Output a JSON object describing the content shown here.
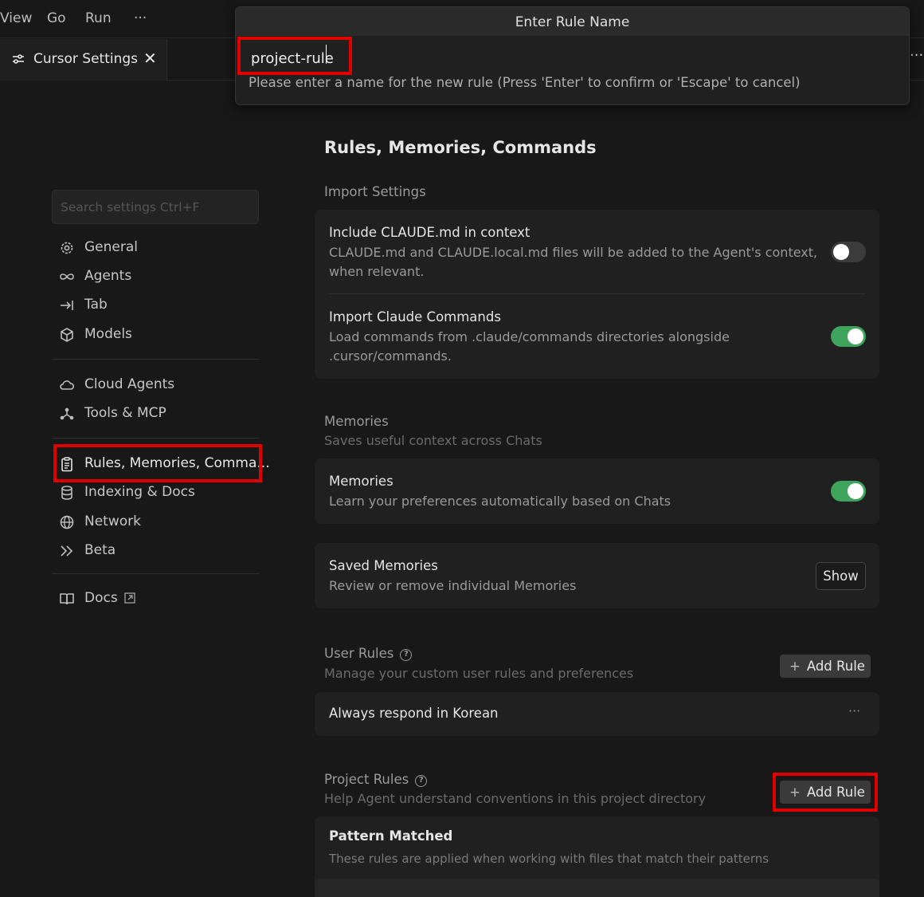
{
  "menubar": {
    "items": [
      "View",
      "Go",
      "Run",
      "···"
    ]
  },
  "tab": {
    "label": "Cursor Settings",
    "close": "✕",
    "more": "···"
  },
  "palette": {
    "title": "Enter Rule Name",
    "value": "project-rule",
    "message": "Please enter a name for the new rule (Press 'Enter' to confirm or 'Escape' to cancel)"
  },
  "sidebar": {
    "search_placeholder": "Search settings Ctrl+F",
    "groups": [
      [
        {
          "label": "General",
          "icon": "gear-icon"
        },
        {
          "label": "Agents",
          "icon": "infinity-icon"
        },
        {
          "label": "Tab",
          "icon": "tab-arrow-icon"
        },
        {
          "label": "Models",
          "icon": "cube-icon"
        }
      ],
      [
        {
          "label": "Cloud Agents",
          "icon": "cloud-icon"
        },
        {
          "label": "Tools & MCP",
          "icon": "nodes-icon"
        }
      ],
      [
        {
          "label": "Rules, Memories, Comma...",
          "icon": "clipboard-icon",
          "active": true
        },
        {
          "label": "Indexing & Docs",
          "icon": "database-icon"
        },
        {
          "label": "Network",
          "icon": "globe-icon"
        },
        {
          "label": "Beta",
          "icon": "double-chevron-icon"
        }
      ],
      [
        {
          "label": "Docs",
          "icon": "book-icon",
          "external_icon": "external-link-icon"
        }
      ]
    ]
  },
  "main": {
    "title": "Rules, Memories, Commands",
    "import": {
      "title": "Import Settings",
      "rows": [
        {
          "title": "Include CLAUDE.md in context",
          "desc1": "CLAUDE.md and CLAUDE.local.md files will be added to the Agent's context,",
          "desc2": "when relevant.",
          "enabled": false
        },
        {
          "title": "Import Claude Commands",
          "desc1": "Load commands from .claude/commands directories alongside",
          "desc2": ".cursor/commands.",
          "enabled": true
        }
      ]
    },
    "memories": {
      "title": "Memories",
      "subtitle": "Saves useful context across Chats",
      "row": {
        "title": "Memories",
        "desc": "Learn your preferences automatically based on Chats",
        "enabled": true
      },
      "saved": {
        "title": "Saved Memories",
        "desc": "Review or remove individual Memories",
        "button": "Show"
      }
    },
    "user_rules": {
      "title": "User Rules",
      "subtitle": "Manage your custom user rules and preferences",
      "button": "Add Rule",
      "items": [
        {
          "text": "Always respond in Korean",
          "menu": "···"
        }
      ]
    },
    "project_rules": {
      "title": "Project Rules",
      "subtitle": "Help Agent understand conventions in this project directory",
      "button": "Add Rule",
      "group": {
        "title": "Pattern Matched",
        "desc": "These rules are applied when working with files that match their patterns"
      }
    }
  },
  "colors": {
    "accent_red": "#e00000",
    "toggle_on": "#3fa45c",
    "toggle_off": "#3b3b3b"
  }
}
